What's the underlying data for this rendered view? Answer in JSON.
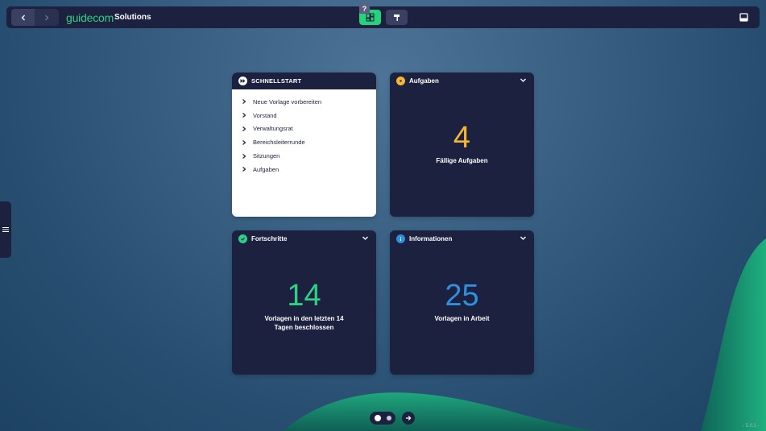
{
  "topbar": {
    "brand": "guidecom",
    "title": "Solutions",
    "back_icon": "chevron-left-icon",
    "forward_icon": "chevron-right-icon",
    "active_view": "dashboard",
    "accent": "#28d17c"
  },
  "quickstart": {
    "title": "SCHNELLSTART",
    "help_label": "?",
    "items": [
      {
        "label": "Neue Vorlage vorbereiten"
      },
      {
        "label": "Vorstand"
      },
      {
        "label": "Verwaltungsrat"
      },
      {
        "label": "Bereichsleiterrunde"
      },
      {
        "label": "Sitzungen"
      },
      {
        "label": "Aufgaben"
      }
    ]
  },
  "cards": {
    "tasks": {
      "title": "Aufgaben",
      "value": "4",
      "caption": "Fällige Aufgaben",
      "color": "#f5b731"
    },
    "progress": {
      "title": "Fortschritte",
      "value": "14",
      "caption": "Vorlagen in den letzten 14 Tagen beschlossen",
      "color": "#2ed184"
    },
    "info": {
      "title": "Informationen",
      "value": "25",
      "caption": "Vorlagen in Arbeit",
      "color": "#2f8fe0"
    }
  },
  "pager": {
    "pages": 2,
    "current": 1
  },
  "version": "- 5.0.1 -"
}
